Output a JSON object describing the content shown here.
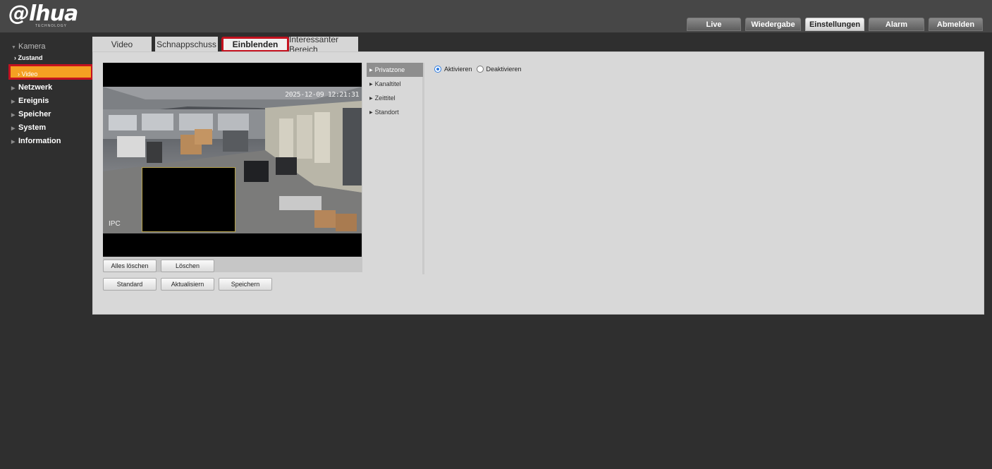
{
  "brand": {
    "logo_text": "@lhua",
    "logo_sub": "TECHNOLOGY"
  },
  "topnav": [
    {
      "label": "Live",
      "active": false
    },
    {
      "label": "Wiedergabe",
      "active": false
    },
    {
      "label": "Einstellungen",
      "active": true
    },
    {
      "label": "Alarm",
      "active": false
    },
    {
      "label": "Abmelden",
      "active": false
    }
  ],
  "sidebar": {
    "camera": "Kamera",
    "camera_items": [
      "Zustand",
      "Video"
    ],
    "sections": [
      "Netzwerk",
      "Ereignis",
      "Speicher",
      "System",
      "Information"
    ]
  },
  "tabs": [
    {
      "label": "Video",
      "active": false
    },
    {
      "label": "Schnappschuss",
      "active": false
    },
    {
      "label": "Einblenden",
      "active": true
    },
    {
      "label": "Interessanter Bereich",
      "active": false
    }
  ],
  "video": {
    "timestamp": "2025-12-09 12:21:31",
    "channel": "IPC"
  },
  "video_buttons": {
    "clear_all": "Alles löschen",
    "delete": "Löschen"
  },
  "bottom_buttons": {
    "default": "Standard",
    "refresh": "Aktualisiern",
    "save": "Speichern"
  },
  "submenu": [
    "Privatzone",
    "Kanaltitel",
    "Zeittitel",
    "Standort"
  ],
  "privacy": {
    "enable": "Aktivieren",
    "disable": "Deaktivieren",
    "selected": "Aktivieren"
  },
  "colors": {
    "accent_active": "#f5a022",
    "highlight_border": "#c4121f",
    "radio": "#2d7be0"
  }
}
